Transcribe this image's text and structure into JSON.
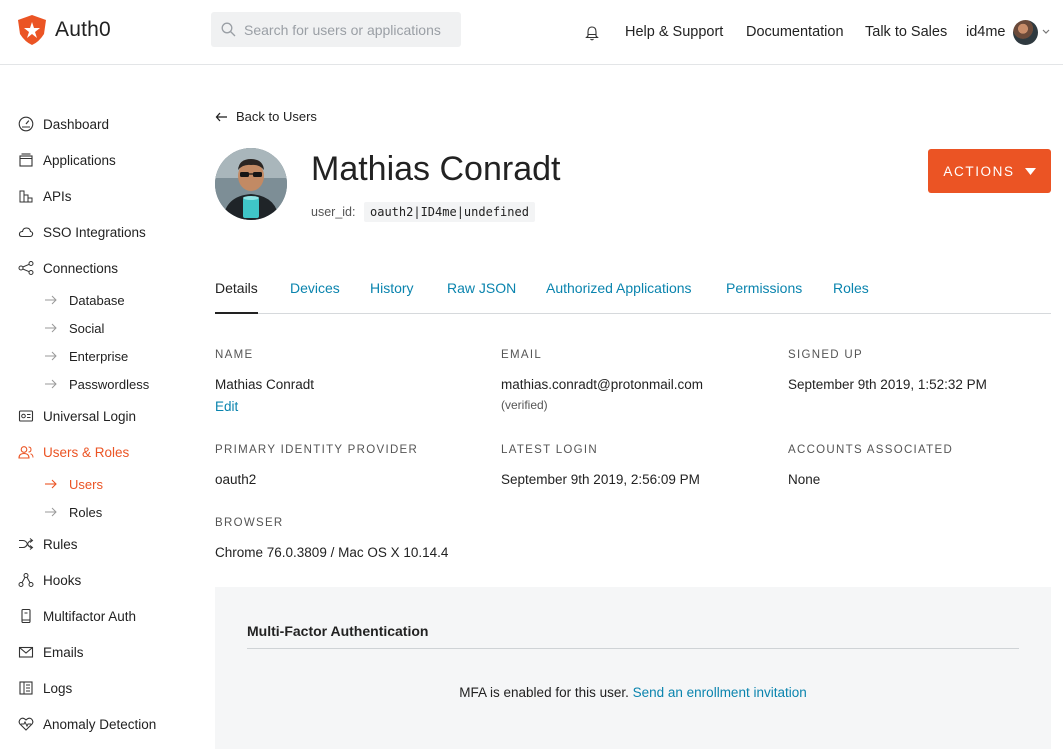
{
  "header": {
    "logo_text": "Auth0",
    "search_placeholder": "Search for users or applications",
    "nav": [
      "Help & Support",
      "Documentation",
      "Talk to Sales"
    ],
    "user_name": "id4me"
  },
  "sidebar": {
    "items": [
      {
        "label": "Dashboard",
        "icon": "dashboard-icon"
      },
      {
        "label": "Applications",
        "icon": "applications-icon"
      },
      {
        "label": "APIs",
        "icon": "apis-icon"
      },
      {
        "label": "SSO Integrations",
        "icon": "cloud-icon"
      },
      {
        "label": "Connections",
        "icon": "connections-icon"
      },
      {
        "label": "Universal Login",
        "icon": "universal-login-icon"
      },
      {
        "label": "Users & Roles",
        "icon": "users-icon"
      },
      {
        "label": "Rules",
        "icon": "rules-icon"
      },
      {
        "label": "Hooks",
        "icon": "hooks-icon"
      },
      {
        "label": "Multifactor Auth",
        "icon": "phone-icon"
      },
      {
        "label": "Emails",
        "icon": "mail-icon"
      },
      {
        "label": "Logs",
        "icon": "logs-icon"
      },
      {
        "label": "Anomaly Detection",
        "icon": "heart-icon"
      }
    ],
    "connections_sub": [
      "Database",
      "Social",
      "Enterprise",
      "Passwordless"
    ],
    "users_sub": [
      "Users",
      "Roles"
    ]
  },
  "main": {
    "back_label": "Back to Users",
    "name": "Mathias Conradt",
    "user_id_label": "user_id:",
    "user_id": "oauth2|ID4me|undefined",
    "actions_label": "ACTIONS",
    "tabs": [
      "Details",
      "Devices",
      "History",
      "Raw JSON",
      "Authorized Applications",
      "Permissions",
      "Roles"
    ],
    "fields": {
      "name_label": "Name",
      "name_value": "Mathias Conradt",
      "edit_label": "Edit",
      "email_label": "Email",
      "email_value": "mathias.conradt@protonmail.com",
      "email_status": "(verified)",
      "signed_up_label": "Signed Up",
      "signed_up_value": "September 9th 2019, 1:52:32 PM",
      "idp_label": "Primary Identity Provider",
      "idp_value": "oauth2",
      "latest_login_label": "Latest Login",
      "latest_login_value": "September 9th 2019, 2:56:09 PM",
      "accounts_label": "Accounts Associated",
      "accounts_value": "None",
      "browser_label": "Browser",
      "browser_value": "Chrome 76.0.3809 / Mac OS X 10.14.4"
    },
    "mfa": {
      "title": "Multi-Factor Authentication",
      "text": "MFA is enabled for this user.",
      "link": "Send an enrollment invitation"
    }
  },
  "colors": {
    "accent": "#eb5424",
    "link": "#0a84ae"
  }
}
